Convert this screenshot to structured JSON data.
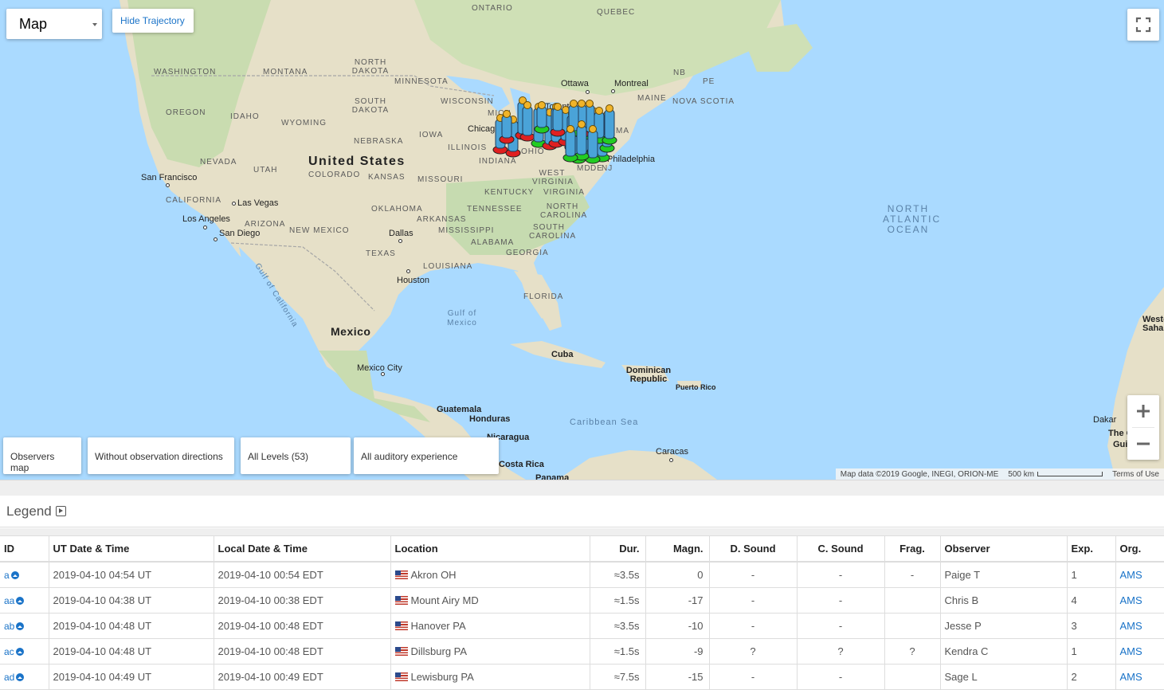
{
  "map": {
    "type_select": "Map",
    "hide_trajectory": "Hide Trajectory",
    "labels": {
      "countries": [
        "United States",
        "Mexico"
      ],
      "states": [
        "WASHINGTON",
        "MONTANA",
        "NORTH DAKOTA",
        "SOUTH DAKOTA",
        "MINNESOTA",
        "WISCONSIN",
        "OREGON",
        "IDAHO",
        "WYOMING",
        "NEBRASKA",
        "IOWA",
        "ILLINOIS",
        "NEVADA",
        "UTAH",
        "COLORADO",
        "KANSAS",
        "MISSOURI",
        "INDIANA",
        "OHIO",
        "CALIFORNIA",
        "ARIZONA",
        "NEW MEXICO",
        "OKLAHOMA",
        "ARKANSAS",
        "KENTUCKY",
        "WEST VIRGINIA",
        "VIRGINIA",
        "TENNESSEE",
        "NORTH CAROLINA",
        "SOUTH CAROLINA",
        "MISSISSIPPI",
        "ALABAMA",
        "GEORGIA",
        "TEXAS",
        "LOUISIANA",
        "FLORIDA",
        "ONTARIO",
        "QUEBEC",
        "NB",
        "PE",
        "MAINE",
        "NOVA SCOTIA",
        "MA",
        "MD",
        "DE",
        "NJ",
        "MICH"
      ],
      "cities": [
        "San Francisco",
        "Las Vegas",
        "Los Angeles",
        "San Diego",
        "Dallas",
        "Houston",
        "Chicago",
        "Toronto",
        "Ottawa",
        "Montreal",
        "Philadelphia",
        "Mexico City",
        "Cuba",
        "Dominican Republic",
        "Puerto Rico",
        "Guatemala",
        "Honduras",
        "Nicaragua",
        "Costa Rica",
        "Panama",
        "Caracas",
        "Dakar",
        "The Gambia",
        "Guinea",
        "Western Sahara"
      ],
      "waters": [
        "North Atlantic Ocean",
        "Gulf of Mexico",
        "Gulf of California",
        "Caribbean Sea"
      ]
    },
    "filters": {
      "observers": "Observers map",
      "directions": "Without observation directions",
      "levels": "All Levels (53)",
      "auditory": "All auditory experience"
    },
    "attribution": {
      "data": "Map data ©2019 Google, INEGI, ORION-ME",
      "scale": "500 km",
      "terms": "Terms of Use"
    },
    "icons": [
      "fullscreen-icon",
      "zoom-in-icon",
      "zoom-out-icon"
    ]
  },
  "legend": {
    "title": "Legend"
  },
  "table": {
    "headers": [
      "ID",
      "UT Date & Time",
      "Local Date & Time",
      "Location",
      "Dur.",
      "Magn.",
      "D. Sound",
      "C. Sound",
      "Frag.",
      "Observer",
      "Exp.",
      "Org."
    ],
    "rows": [
      {
        "id": "a",
        "ut": "2019-04-10 04:54 UT",
        "local": "2019-04-10 00:54 EDT",
        "location": "Akron OH",
        "dur": "≈3.5s",
        "magn": "0",
        "dsound": "-",
        "csound": "-",
        "frag": "-",
        "observer": "Paige T",
        "exp": "1",
        "org": "AMS"
      },
      {
        "id": "aa",
        "ut": "2019-04-10 04:38 UT",
        "local": "2019-04-10 00:38 EDT",
        "location": "Mount Airy MD",
        "dur": "≈1.5s",
        "magn": "-17",
        "dsound": "-",
        "csound": "-",
        "frag": "",
        "observer": "Chris B",
        "exp": "4",
        "org": "AMS"
      },
      {
        "id": "ab",
        "ut": "2019-04-10 04:48 UT",
        "local": "2019-04-10 00:48 EDT",
        "location": "Hanover PA",
        "dur": "≈3.5s",
        "magn": "-10",
        "dsound": "-",
        "csound": "-",
        "frag": "",
        "observer": "Jesse P",
        "exp": "3",
        "org": "AMS"
      },
      {
        "id": "ac",
        "ut": "2019-04-10 04:48 UT",
        "local": "2019-04-10 00:48 EDT",
        "location": "Dillsburg PA",
        "dur": "≈1.5s",
        "magn": "-9",
        "dsound": "?",
        "csound": "?",
        "frag": "?",
        "observer": "Kendra C",
        "exp": "1",
        "org": "AMS"
      },
      {
        "id": "ad",
        "ut": "2019-04-10 04:49 UT",
        "local": "2019-04-10 00:49 EDT",
        "location": "Lewisburg PA",
        "dur": "≈7.5s",
        "magn": "-15",
        "dsound": "-",
        "csound": "-",
        "frag": "",
        "observer": "Sage L",
        "exp": "2",
        "org": "AMS"
      }
    ]
  }
}
